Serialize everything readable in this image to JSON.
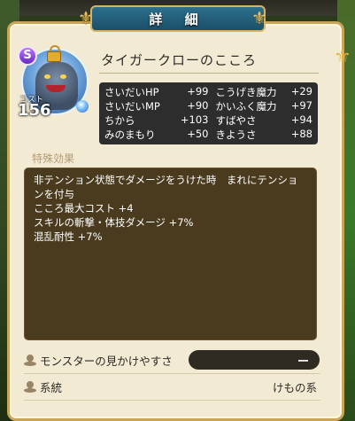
{
  "window": {
    "title": "詳 細"
  },
  "monster": {
    "rank_badge": "S",
    "cost_label": "コスト",
    "cost_value": "156",
    "heart_name": "タイガークローのこころ"
  },
  "stats": [
    [
      {
        "label": "さいだいHP",
        "value": "+99"
      },
      {
        "label": "こうげき魔力",
        "value": "+29"
      }
    ],
    [
      {
        "label": "さいだいMP",
        "value": "+90"
      },
      {
        "label": "かいふく魔力",
        "value": "+97"
      }
    ],
    [
      {
        "label": "ちから",
        "value": "+103"
      },
      {
        "label": "すばやさ",
        "value": "+94"
      }
    ],
    [
      {
        "label": "みのまもり",
        "value": "+50"
      },
      {
        "label": "きようさ",
        "value": "+88"
      }
    ]
  ],
  "effects": {
    "section_title": "特殊効果",
    "lines": [
      "非テンション状態でダメージをうけた時　まれにテンショ",
      "ンを付与",
      "こころ最大コスト +4",
      "スキルの斬撃・体技ダメージ +7%",
      "混乱耐性 +7%"
    ]
  },
  "info": {
    "visibility_label": "モンスターの見かけやすさ",
    "visibility_value": "ー",
    "family_label": "系統",
    "family_value": "けもの系"
  },
  "icons": {
    "lock": "lock-icon",
    "orb": "blue-orb-icon",
    "pin": "pin-icon"
  },
  "colors": {
    "title_banner": "#1b4f68",
    "panel_bg": "#f3ead3",
    "stats_bg": "#2d2d2d",
    "effects_bg": "#4a3b1f"
  }
}
